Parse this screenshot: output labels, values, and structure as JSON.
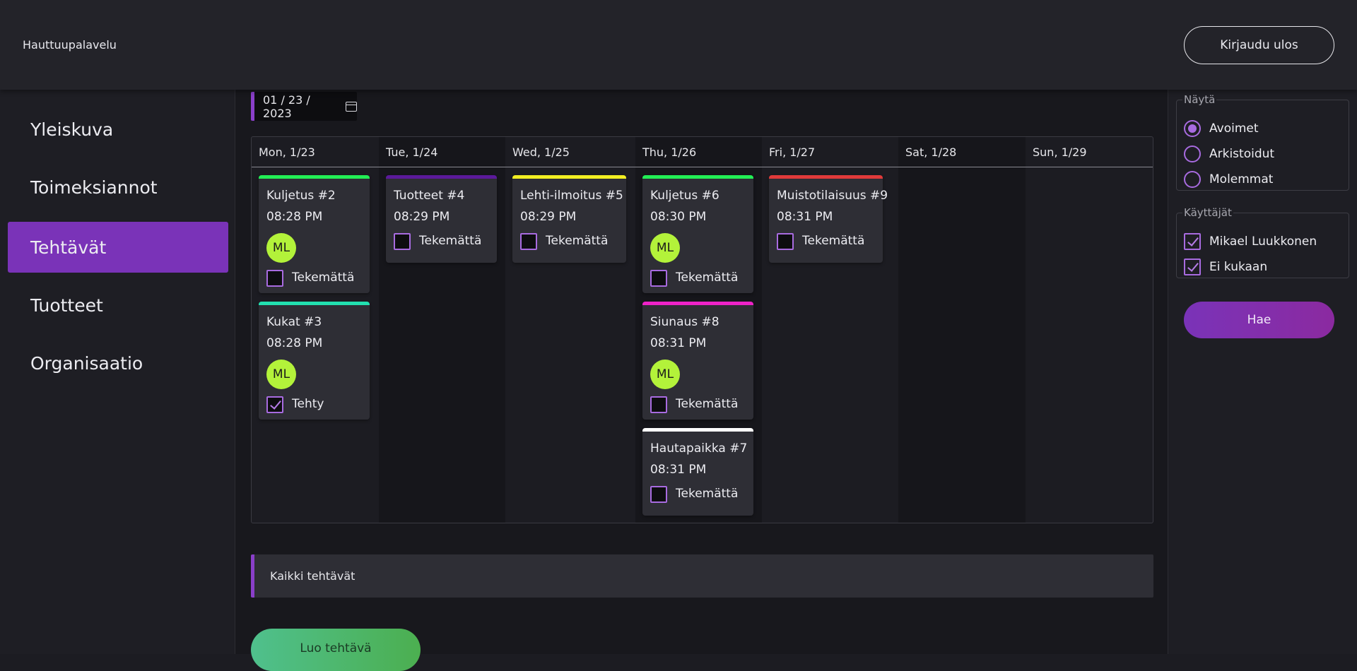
{
  "header": {
    "brand": "Hauttuupalavelu",
    "logout_label": "Kirjaudu ulos"
  },
  "sidebar": {
    "items": [
      {
        "label": "Yleiskuva",
        "active": false
      },
      {
        "label": "Toimeksiannot",
        "active": false
      },
      {
        "label": "Tehtävät",
        "active": true
      },
      {
        "label": "Tuotteet",
        "active": false
      },
      {
        "label": "Organisaatio",
        "active": false
      }
    ]
  },
  "date_picker": {
    "value": "01 / 23 / 2023",
    "icon": "calendar-icon"
  },
  "calendar": {
    "days": [
      {
        "label": "Mon, 1/23"
      },
      {
        "label": "Tue, 1/24"
      },
      {
        "label": "Wed, 1/25"
      },
      {
        "label": "Thu, 1/26"
      },
      {
        "label": "Fri, 1/27"
      },
      {
        "label": "Sat, 1/28"
      },
      {
        "label": "Sun, 1/29"
      }
    ],
    "tasks": [
      {
        "day": 0,
        "title": "Kuljetus #2",
        "time": "08:28 PM",
        "color": "#22ee55",
        "assignee": "ML",
        "status": "Tekemättä",
        "done": false
      },
      {
        "day": 0,
        "title": "Kukat #3",
        "time": "08:28 PM",
        "color": "#22e0b0",
        "assignee": "ML",
        "status": "Tehty",
        "done": true
      },
      {
        "day": 1,
        "title": "Tuotteet #4",
        "time": "08:29 PM",
        "color": "#5b1a9a",
        "assignee": "",
        "status": "Tekemättä",
        "done": false
      },
      {
        "day": 2,
        "title": "Lehti-ilmoitus #5",
        "time": "08:29 PM",
        "color": "#f2ee22",
        "assignee": "",
        "status": "Tekemättä",
        "done": false
      },
      {
        "day": 3,
        "title": "Kuljetus #6",
        "time": "08:30 PM",
        "color": "#22ee55",
        "assignee": "ML",
        "status": "Tekemättä",
        "done": false
      },
      {
        "day": 3,
        "title": "Siunaus #8",
        "time": "08:31 PM",
        "color": "#ee22c8",
        "assignee": "ML",
        "status": "Tekemättä",
        "done": false
      },
      {
        "day": 3,
        "title": "Hautapaikka #7",
        "time": "08:31 PM",
        "color": "#ffffff",
        "assignee": "",
        "status": "Tekemättä",
        "done": false
      },
      {
        "day": 4,
        "title": "Muistotilaisuus #9",
        "time": "08:31 PM",
        "color": "#e03a3a",
        "assignee": "",
        "status": "Tekemättä",
        "done": false
      }
    ]
  },
  "all_tasks_label": "Kaikki tehtävät",
  "create_task_label": "Luo tehtävä",
  "filters": {
    "show": {
      "legend": "Näytä",
      "options": [
        {
          "label": "Avoimet",
          "selected": true
        },
        {
          "label": "Arkistoidut",
          "selected": false
        },
        {
          "label": "Molemmat",
          "selected": false
        }
      ]
    },
    "users": {
      "legend": "Käyttäjät",
      "options": [
        {
          "label": "Mikael Luukkonen",
          "checked": true
        },
        {
          "label": "Ei kukaan",
          "checked": true
        }
      ]
    },
    "search_label": "Hae"
  }
}
